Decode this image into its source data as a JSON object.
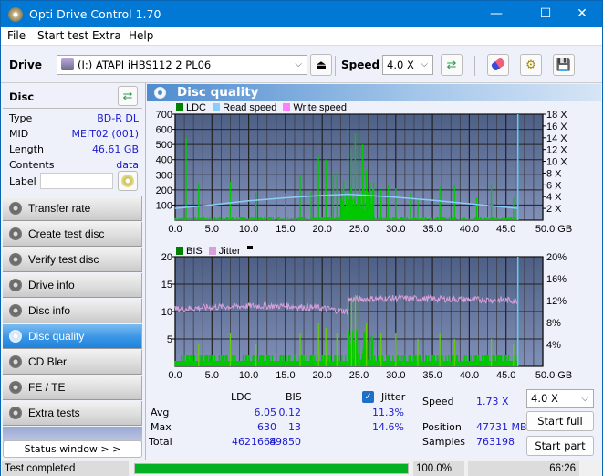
{
  "window": {
    "title": "Opti Drive Control 1.70",
    "minimize": "—",
    "maximize": "☐",
    "close": "✕"
  },
  "menu": [
    "File",
    "Start test",
    "Extra",
    "Help"
  ],
  "toolbar": {
    "drive_label": "Drive",
    "drive_value": "(I:)  ATAPI iHBS112  2 PL06",
    "speed_label": "Speed",
    "speed_value": "4.0 X",
    "icons": [
      "eject-icon",
      "refresh-icon",
      "erase-icon",
      "settings-icon",
      "save-icon"
    ]
  },
  "disc": {
    "header": "Disc",
    "rows": [
      {
        "key": "Type",
        "value": "BD-R DL"
      },
      {
        "key": "MID",
        "value": "MEIT02 (001)"
      },
      {
        "key": "Length",
        "value": "46.61 GB"
      },
      {
        "key": "Contents",
        "value": "data"
      }
    ],
    "label_key": "Label",
    "label_value": ""
  },
  "nav": [
    {
      "label": "Transfer rate",
      "active": false
    },
    {
      "label": "Create test disc",
      "active": false
    },
    {
      "label": "Verify test disc",
      "active": false
    },
    {
      "label": "Drive info",
      "active": false
    },
    {
      "label": "Disc info",
      "active": false
    },
    {
      "label": "Disc quality",
      "active": true
    },
    {
      "label": "CD Bler",
      "active": false
    },
    {
      "label": "FE / TE",
      "active": false
    },
    {
      "label": "Extra tests",
      "active": false
    }
  ],
  "status_window_button": "Status window > >",
  "main": {
    "title": "Disc quality",
    "chart1_legend": [
      {
        "label": "LDC",
        "color": "#008000"
      },
      {
        "label": "Read speed",
        "color": "#87cefa"
      },
      {
        "label": "Write speed",
        "color": "#ff80ff"
      }
    ],
    "chart2_legend": [
      {
        "label": "BIS",
        "color": "#008000"
      },
      {
        "label": "Jitter",
        "color": "#d8a0d8"
      }
    ]
  },
  "chart_data": [
    {
      "type": "bar",
      "title": "LDC / Read speed",
      "xlabel": "GB",
      "x_ticks": [
        "0.0",
        "5.0",
        "10.0",
        "15.0",
        "20.0",
        "25.0",
        "30.0",
        "35.0",
        "40.0",
        "45.0",
        "50.0 GB"
      ],
      "xlim": [
        0,
        50
      ],
      "y_ticks": [
        "100",
        "200",
        "300",
        "400",
        "500",
        "600",
        "700"
      ],
      "ylim": [
        0,
        700
      ],
      "y2_ticks": [
        "2 X",
        "4 X",
        "6 X",
        "8 X",
        "10 X",
        "12 X",
        "14 X",
        "16 X",
        "18 X"
      ],
      "y2lim": [
        0,
        18
      ],
      "end_marker_gb": 46.61,
      "series": [
        {
          "name": "LDC",
          "color": "#00c800",
          "peaks": [
            [
              1.5,
              545
            ],
            [
              3.2,
              240
            ],
            [
              7.5,
              255
            ],
            [
              11,
              185
            ],
            [
              15,
              180
            ],
            [
              17,
              300
            ],
            [
              18.5,
              190
            ],
            [
              19.5,
              420
            ],
            [
              20.5,
              400
            ],
            [
              21.5,
              310
            ],
            [
              22,
              310
            ],
            [
              23.5,
              620
            ],
            [
              24,
              470
            ],
            [
              24.5,
              570
            ],
            [
              25,
              580
            ],
            [
              25.5,
              500
            ],
            [
              26,
              330
            ],
            [
              27,
              250
            ],
            [
              28,
              200
            ],
            [
              29,
              230
            ],
            [
              30,
              210
            ],
            [
              32,
              180
            ],
            [
              33,
              150
            ],
            [
              36,
              220
            ],
            [
              38,
              230
            ],
            [
              41,
              150
            ],
            [
              43,
              240
            ],
            [
              46,
              150
            ]
          ]
        },
        {
          "name": "Read speed",
          "color": "#87cefa",
          "points": [
            [
              0,
              2.0
            ],
            [
              5,
              2.6
            ],
            [
              10,
              3.3
            ],
            [
              15,
              3.8
            ],
            [
              20,
              4.2
            ],
            [
              23.5,
              4.4
            ],
            [
              25,
              4.3
            ],
            [
              30,
              3.9
            ],
            [
              35,
              3.4
            ],
            [
              40,
              2.8
            ],
            [
              46.6,
              2.0
            ]
          ]
        }
      ]
    },
    {
      "type": "bar",
      "title": "BIS / Jitter",
      "xlabel": "GB",
      "x_ticks": [
        "0.0",
        "5.0",
        "10.0",
        "15.0",
        "20.0",
        "25.0",
        "30.0",
        "35.0",
        "40.0",
        "45.0",
        "50.0 GB"
      ],
      "xlim": [
        0,
        50
      ],
      "y_ticks": [
        "5",
        "10",
        "15",
        "20"
      ],
      "ylim": [
        0,
        20
      ],
      "y2_ticks": [
        "4%",
        "8%",
        "12%",
        "16%",
        "20%"
      ],
      "y2lim": [
        0,
        20
      ],
      "end_marker_gb": 46.61,
      "series": [
        {
          "name": "BIS",
          "color": "#00c800",
          "peaks": [
            [
              3.2,
              4
            ],
            [
              7.5,
              6
            ],
            [
              11,
              4
            ],
            [
              17,
              6
            ],
            [
              19.5,
              8
            ],
            [
              20.5,
              7
            ],
            [
              22,
              6
            ],
            [
              23.5,
              13
            ],
            [
              24,
              12
            ],
            [
              24.5,
              13
            ],
            [
              25,
              12
            ],
            [
              26,
              8
            ],
            [
              28,
              6
            ],
            [
              30,
              6
            ],
            [
              33,
              5
            ],
            [
              36,
              6
            ],
            [
              38,
              5
            ],
            [
              43,
              5
            ],
            [
              46,
              4
            ]
          ]
        },
        {
          "name": "Jitter",
          "color": "#d8a0d8",
          "points": [
            [
              0,
              10.4
            ],
            [
              5,
              10.8
            ],
            [
              10,
              11.0
            ],
            [
              15,
              11.0
            ],
            [
              20,
              10.6
            ],
            [
              23.4,
              10.0
            ],
            [
              23.6,
              12.2
            ],
            [
              30,
              12.4
            ],
            [
              35,
              12.3
            ],
            [
              40,
              12.2
            ],
            [
              46.6,
              12.0
            ]
          ]
        }
      ]
    }
  ],
  "stats": {
    "col_ldc": "LDC",
    "col_bis": "BIS",
    "jitter_label": "Jitter",
    "jitter_checked": true,
    "rows": [
      {
        "label": "Avg",
        "ldc": "6.05",
        "bis": "0.12",
        "jitter": "11.3%"
      },
      {
        "label": "Max",
        "ldc": "630",
        "bis": "13",
        "jitter": "14.6%"
      },
      {
        "label": "Total",
        "ldc": "4621664",
        "bis": "89850",
        "jitter": ""
      }
    ],
    "speed_label": "Speed",
    "speed_value": "1.73 X",
    "position_label": "Position",
    "position_value": "47731 MB",
    "samples_label": "Samples",
    "samples_value": "763198",
    "speed_select": "4.0 X",
    "start_full": "Start full",
    "start_part": "Start part"
  },
  "statusbar": {
    "text": "Test completed",
    "progress_percent": 100,
    "progress_text": "100.0%",
    "time": "66:26"
  }
}
